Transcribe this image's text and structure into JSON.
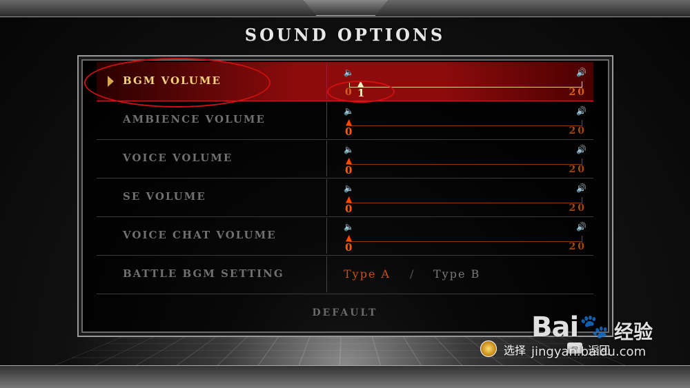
{
  "screen": {
    "title": "SOUND OPTIONS"
  },
  "options": [
    {
      "label": "BGM VOLUME",
      "type": "slider",
      "value": 1,
      "min": "0",
      "max": "20",
      "selected": true
    },
    {
      "label": "AMBIENCE VOLUME",
      "type": "slider",
      "value": 0,
      "min": "0",
      "max": "20",
      "selected": false
    },
    {
      "label": "VOICE VOLUME",
      "type": "slider",
      "value": 0,
      "min": "0",
      "max": "20",
      "selected": false
    },
    {
      "label": "SE VOLUME",
      "type": "slider",
      "value": 0,
      "min": "0",
      "max": "20",
      "selected": false
    },
    {
      "label": "VOICE CHAT VOLUME",
      "type": "slider",
      "value": 0,
      "min": "0",
      "max": "20",
      "selected": false
    },
    {
      "label": "BATTLE BGM SETTING",
      "type": "toggle",
      "option_a": "Type A",
      "separator": "/",
      "option_b": "Type B",
      "active": "Type A",
      "selected": false
    }
  ],
  "default_button": "DEFAULT",
  "footer": {
    "select_label": "选择",
    "back_label": "返回"
  },
  "watermark": {
    "logo": "Bai",
    "suffix": "经验",
    "url": "jingyan.baidu.com"
  },
  "icons": {
    "cursor": "triangle-cursor-icon",
    "speaker": "speaker-icon",
    "dpad": "dpad-icon",
    "back_key": "back-button-icon",
    "paw": "baidu-paw-icon"
  },
  "colors": {
    "selected_row": "#8c0b0b",
    "selected_label": "#f2d27a",
    "active_value": "#ff5a00",
    "inactive_label": "#707070",
    "annotation_ring": "#d01010"
  }
}
